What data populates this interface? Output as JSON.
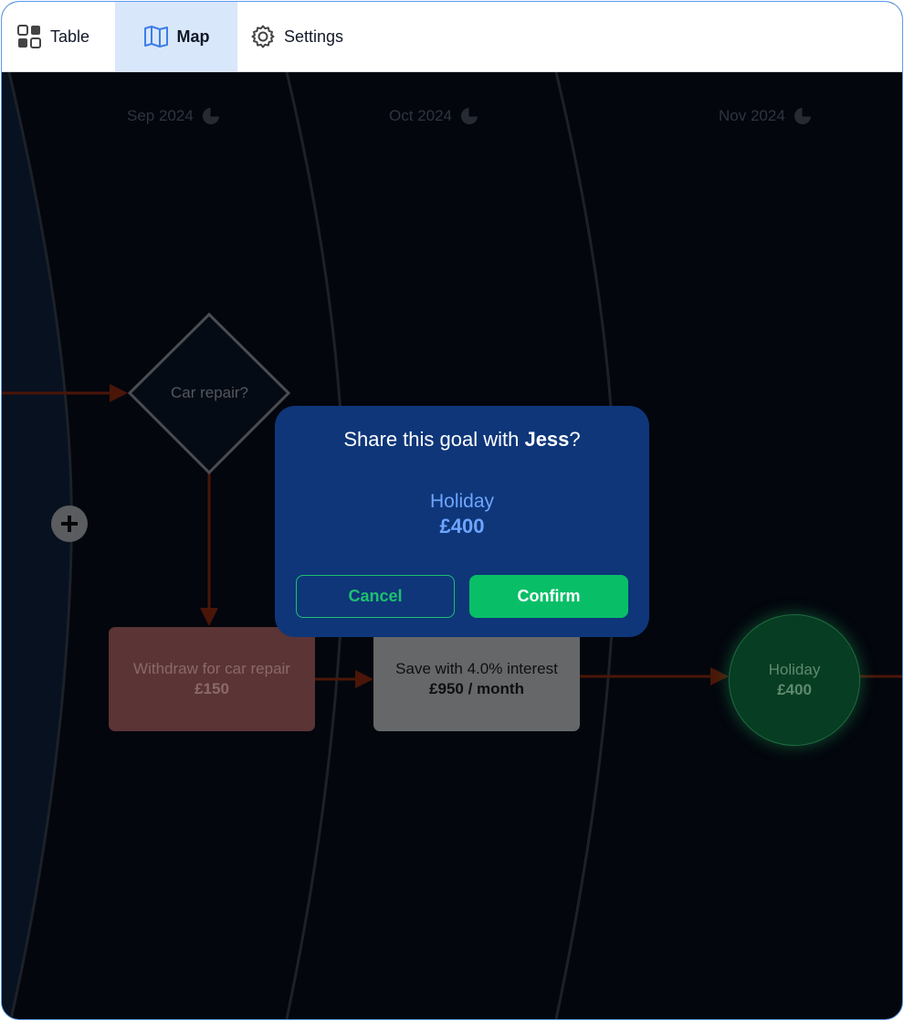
{
  "tabs": [
    {
      "label": "Table",
      "icon": "grid-icon"
    },
    {
      "label": "Map",
      "icon": "map-icon",
      "active": true
    },
    {
      "label": "Settings",
      "icon": "gear-icon"
    }
  ],
  "months": [
    "Sep 2024",
    "Oct 2024",
    "Nov 2024"
  ],
  "nodes": {
    "decision": {
      "label": "Car repair?"
    },
    "withdraw": {
      "label": "Withdraw for car repair",
      "amount": "£150"
    },
    "save": {
      "label": "Save with 4.0% interest",
      "amount": "£950 / month"
    },
    "goal": {
      "label": "Holiday",
      "amount": "£400"
    }
  },
  "dialog": {
    "title_prefix": "Share this goal with ",
    "title_name": "Jess",
    "title_suffix": "?",
    "goal_name": "Holiday",
    "goal_amount": "£400",
    "cancel_label": "Cancel",
    "confirm_label": "Confirm"
  },
  "colors": {
    "accent": "#5b9bf0",
    "dialog_bg": "#0e3679",
    "confirm": "#08bf67",
    "goal_text": "#6ea5ff",
    "arrow": "#4a1608"
  }
}
